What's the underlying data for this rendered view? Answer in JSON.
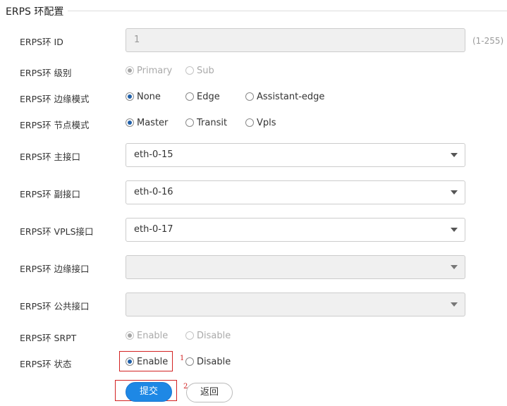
{
  "section": {
    "title": "ERPS 环配置"
  },
  "ring_id": {
    "label": "ERPS环 ID",
    "value": "1",
    "hint": "(1-255)"
  },
  "level": {
    "label": "ERPS环 级别",
    "options": [
      "Primary",
      "Sub"
    ],
    "selected": "Primary",
    "disabled": true
  },
  "edge_mode": {
    "label": "ERPS环 边缘模式",
    "options": [
      "None",
      "Edge",
      "Assistant-edge"
    ],
    "selected": "None"
  },
  "node_mode": {
    "label": "ERPS环 节点模式",
    "options": [
      "Master",
      "Transit",
      "Vpls"
    ],
    "selected": "Master"
  },
  "primary_port": {
    "label": "ERPS环 主接口",
    "value": "eth-0-15"
  },
  "secondary_port": {
    "label": "ERPS环 副接口",
    "value": "eth-0-16"
  },
  "vpls_port": {
    "label": "ERPS环 VPLS接口",
    "value": "eth-0-17"
  },
  "edge_port": {
    "label": "ERPS环 边缘接口",
    "value": "",
    "disabled": true
  },
  "common_port": {
    "label": "ERPS环 公共接口",
    "value": "",
    "disabled": true
  },
  "srpt": {
    "label": "ERPS环 SRPT",
    "options": [
      "Enable",
      "Disable"
    ],
    "selected": "Enable",
    "disabled": true
  },
  "state": {
    "label": "ERPS环 状态",
    "options": [
      "Enable",
      "Disable"
    ],
    "selected": "Enable"
  },
  "actions": {
    "submit": "提交",
    "back": "返回"
  },
  "annotations": {
    "step1": "1",
    "step2": "2",
    "color": "#d32222"
  },
  "colors": {
    "accent": "#1e88e5",
    "radio_selected": "#1f5fa8"
  }
}
